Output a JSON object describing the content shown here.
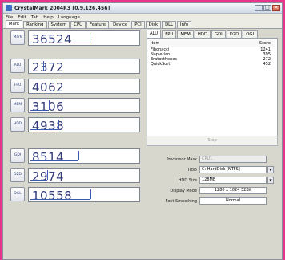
{
  "window": {
    "title": "CrystalMark 2004R3 [0.9.126.456]"
  },
  "menu": [
    "File",
    "Edit",
    "Tab",
    "Help",
    "Language"
  ],
  "tabs": [
    "Mark",
    "Ranking",
    "System",
    "CPU",
    "Feature",
    "Device",
    "PCI",
    "Disk",
    "DLL",
    "Info"
  ],
  "rows": [
    {
      "label": "Mark",
      "score": "36524",
      "bar": 0.55
    },
    {
      "label": "ALU",
      "score": "2372",
      "bar": 0.12
    },
    {
      "label": "FPU",
      "score": "4062",
      "bar": 0.22
    },
    {
      "label": "MEM",
      "score": "3106",
      "bar": 0.17
    },
    {
      "label": "HDD",
      "score": "4938",
      "bar": 0.26
    },
    {
      "label": "GDI",
      "score": "8514",
      "bar": 0.45
    },
    {
      "label": "D2D",
      "score": "2974",
      "bar": 0.16
    },
    {
      "label": "OGL",
      "score": "10558",
      "bar": 0.56
    }
  ],
  "subtabs": [
    "ALU",
    "FPU",
    "MEM",
    "HDD",
    "GDI",
    "D2D",
    "OGL"
  ],
  "table": {
    "col_item": "Item",
    "col_score": "Score",
    "rows": [
      {
        "item": "Fibonacci",
        "score": "1241"
      },
      {
        "item": "Napierian",
        "score": "395"
      },
      {
        "item": "Eratosthenes",
        "score": "272"
      },
      {
        "item": "QuickSort",
        "score": "452"
      }
    ]
  },
  "stop_label": "Stop",
  "fields": {
    "processor_mask_label": "Processor Mask",
    "processor_mask_value": "CPU1",
    "hdd_label": "HDD",
    "hdd_value": "C: HardDisk [NTFS]",
    "hdd_size_label": "HDD Size",
    "hdd_size_value": "128MB",
    "display_mode_label": "Display Mode",
    "display_mode_value": "1280 x 1024 32Bit",
    "font_smoothing_label": "Font Smoothing",
    "font_smoothing_value": "Normal"
  },
  "window_buttons": {
    "minimize": "_",
    "maximize": "□",
    "close": "×"
  }
}
